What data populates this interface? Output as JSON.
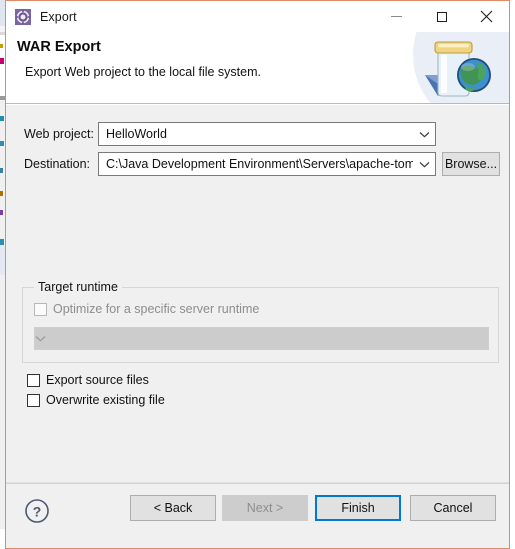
{
  "window": {
    "title": "Export",
    "icon": "export-gear-icon",
    "minimize_label": "Minimize",
    "maximize_label": "Maximize",
    "close_label": "Close",
    "border_color": "#e08a67"
  },
  "banner": {
    "title": "WAR Export",
    "description": "Export Web project to the local file system.",
    "art_icon": "war-jar-globe-icon"
  },
  "form": {
    "web_project": {
      "label": "Web project:",
      "value": "HelloWorld",
      "dropdown_icon": "chevron-down-icon"
    },
    "destination": {
      "label": "Destination:",
      "value": "C:\\Java Development Environment\\Servers\\apache-tomcat-",
      "dropdown_icon": "chevron-down-icon",
      "browse_label": "Browse..."
    },
    "target_runtime": {
      "legend": "Target runtime",
      "optimize_label": "Optimize for a specific server runtime",
      "optimize_checked": false,
      "optimize_enabled": false,
      "runtime_value": "",
      "runtime_enabled": false,
      "dropdown_icon": "chevron-down-icon"
    },
    "options": [
      {
        "label": "Export source files",
        "checked": false
      },
      {
        "label": "Overwrite existing file",
        "checked": false
      }
    ]
  },
  "footer": {
    "help_label": "?",
    "help_icon": "help-question-icon",
    "buttons": [
      {
        "label": "< Back",
        "state": "enabled"
      },
      {
        "label": "Next >",
        "state": "disabled"
      },
      {
        "label": "Finish",
        "state": "default"
      },
      {
        "label": "Cancel",
        "state": "enabled"
      }
    ],
    "focus_color": "#0078d7"
  }
}
